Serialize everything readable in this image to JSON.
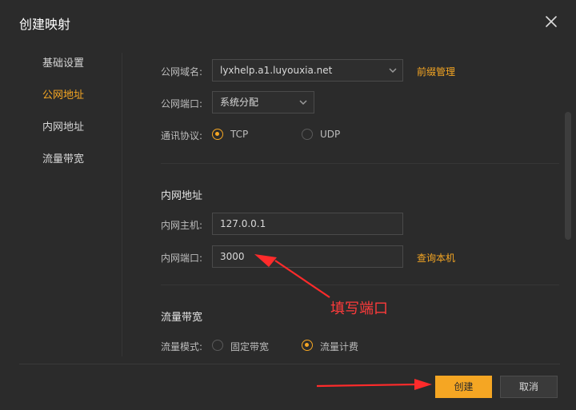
{
  "dialog": {
    "title": "创建映射"
  },
  "sidebar": {
    "items": [
      {
        "label": "基础设置"
      },
      {
        "label": "公网地址"
      },
      {
        "label": "内网地址"
      },
      {
        "label": "流量带宽"
      }
    ]
  },
  "public": {
    "domain_label": "公网域名:",
    "domain_value": "lyxhelp.a1.luyouxia.net",
    "prefix_link": "前缀管理",
    "port_label": "公网端口:",
    "port_value": "系统分配",
    "protocol_label": "通讯协议:",
    "protocol_options": [
      "TCP",
      "UDP"
    ],
    "protocol_selected": "TCP"
  },
  "private": {
    "section_title": "内网地址",
    "host_label": "内网主机:",
    "host_value": "127.0.0.1",
    "port_label": "内网端口:",
    "port_value": "3000",
    "query_link": "查询本机"
  },
  "bandwidth": {
    "section_title": "流量带宽",
    "mode_label": "流量模式:",
    "mode_options": [
      "固定带宽",
      "流量计费"
    ],
    "mode_selected": "流量计费"
  },
  "annotation": {
    "text": "填写端口",
    "color": "#ff3b3b"
  },
  "buttons": {
    "create": "创建",
    "cancel": "取消"
  },
  "colors": {
    "accent": "#f5a623",
    "background": "#2b2b2b"
  }
}
